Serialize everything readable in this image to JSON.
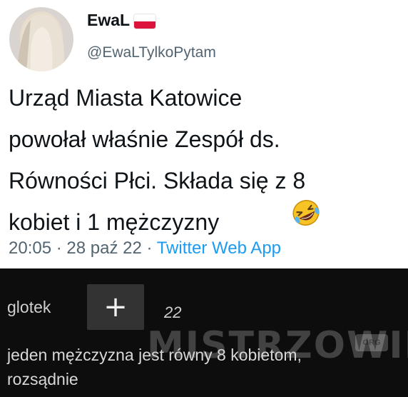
{
  "tweet": {
    "display_name": "EwaL",
    "handle": "@EwaLTylkoPytam",
    "text": "Urząd Miasta Katowice\npowołał właśnie Zespół ds.\nRówności Płci. Składa się z 8\nkobiet i 1 mężczyzny",
    "timestamp": "20:05 · 28 paź 22 · ",
    "source": "Twitter Web App",
    "emoji": "rolling-on-floor-laughing-icon",
    "colors": {
      "link": "#1d9bf0",
      "meta": "#536471",
      "text": "#0f1419"
    }
  },
  "comment": {
    "username": "glotek",
    "plus_label": "+",
    "score": "22",
    "watermark": "MISTRZOWIE",
    "watermark_badge": "ORG",
    "text": "jeden mężczyzna jest równy 8 kobietom,\nrozsądnie"
  }
}
